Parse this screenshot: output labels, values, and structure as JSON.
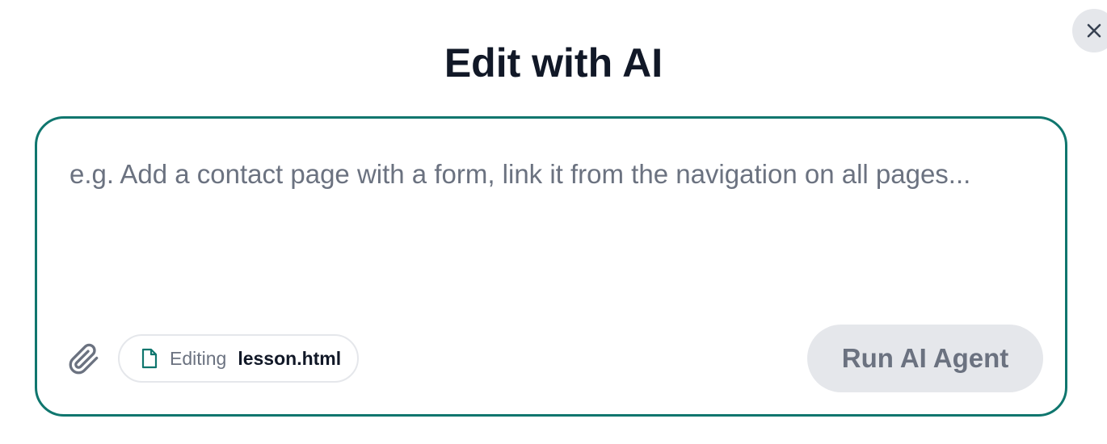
{
  "dialog": {
    "title": "Edit with AI"
  },
  "prompt": {
    "value": "",
    "placeholder": "e.g. Add a contact page with a form, link it from the navigation on all pages..."
  },
  "file_chip": {
    "label": "Editing",
    "filename": "lesson.html"
  },
  "actions": {
    "run_label": "Run AI Agent"
  },
  "icons": {
    "close": "close-icon",
    "attach": "paperclip-icon",
    "file": "file-icon"
  },
  "colors": {
    "accent": "#0f766e",
    "title": "#111827",
    "muted": "#6b7280",
    "button_bg": "#e5e7eb"
  }
}
